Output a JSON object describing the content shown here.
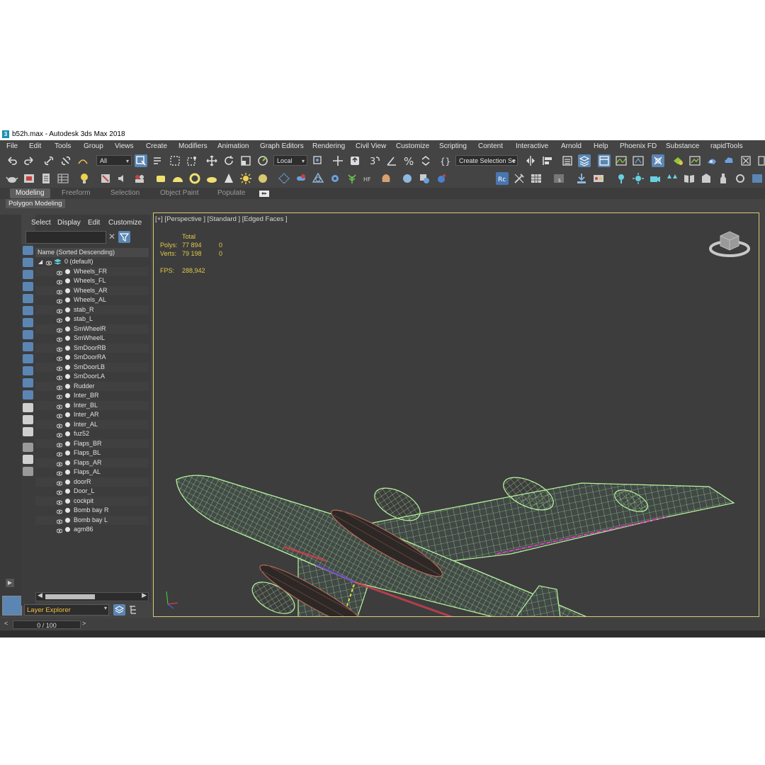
{
  "window": {
    "title": "b52h.max - Autodesk 3ds Max 2018",
    "logo_letter": "3"
  },
  "menu": [
    "File",
    "Edit",
    "Tools",
    "Group",
    "Views",
    "Create",
    "Modifiers",
    "Animation",
    "Graph Editors",
    "Rendering",
    "Civil View",
    "Customize",
    "Scripting",
    "Content",
    "Interactive",
    "Arnold",
    "Help",
    "Phoenix FD",
    "Substance",
    "rapidTools"
  ],
  "toolbar": {
    "selection_filter": "All",
    "coord_system": "Local",
    "selection_set": "Create Selection Se"
  },
  "ribbon": {
    "tabs": [
      "Modeling",
      "Freeform",
      "Selection",
      "Object Paint",
      "Populate"
    ],
    "active_tab": "Modeling",
    "panel_label": "Polygon Modeling"
  },
  "explorer": {
    "menu": [
      "Select",
      "Display",
      "Edit",
      "Customize"
    ],
    "column_header": "Name (Sorted Descending)",
    "layer": "0 (default)",
    "objects": [
      "Wheels_FR",
      "Wheels_FL",
      "Wheels_AR",
      "Wheels_AL",
      "stab_R",
      "stab_L",
      "SmWheelR",
      "SmWheelL",
      "SmDoorRB",
      "SmDoorRA",
      "SmDoorLB",
      "SmDoorLA",
      "Rudder",
      "Inter_BR",
      "Inter_BL",
      "Inter_AR",
      "Inter_AL",
      "fuz52",
      "Flaps_BR",
      "Flaps_BL",
      "Flaps_AR",
      "Flaps_AL",
      "doorR",
      "Door_L",
      "cockpit",
      "Bomb bay R",
      "Bomb bay L",
      "agm86"
    ],
    "footer_dropdown": "Layer Explorer"
  },
  "viewport": {
    "label": "[+] [Perspective ] [Standard ] [Edged Faces ]",
    "stats": {
      "header": "Total",
      "polys_label": "Polys:",
      "polys_total": "77 894",
      "polys_sel": "0",
      "verts_label": "Verts:",
      "verts_total": "79 198",
      "verts_sel": "0",
      "fps_label": "FPS:",
      "fps_value": "288,942"
    }
  },
  "timeline": {
    "frame": "0 / 100"
  },
  "colors": {
    "wire": "#b7f5a0",
    "stats": "#e2c84a",
    "viewport_border": "#d7c87a",
    "accent": "#5b86b4"
  }
}
